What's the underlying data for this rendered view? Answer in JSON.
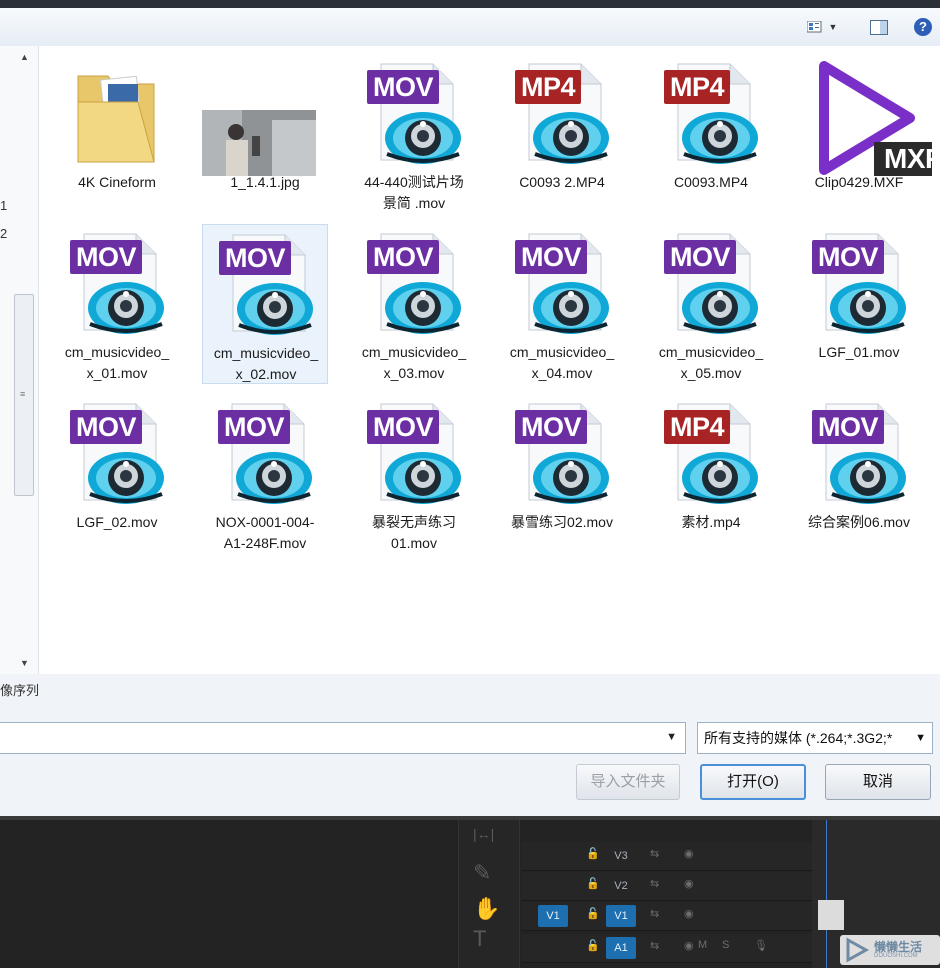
{
  "toolbar": {
    "view_icon": "views-icon",
    "preview_icon": "preview-pane-icon",
    "help_label": "?"
  },
  "sidebar": {
    "numbers": [
      "1",
      "2"
    ]
  },
  "colors": {
    "mov": "#6b2fa3",
    "mp4": "#a82323",
    "mxf": "#7a2fc8",
    "reel": "#10a8d6",
    "selected": "#eaf2fb"
  },
  "files": [
    {
      "kind": "folder",
      "line1": "4K Cineform",
      "line2": ""
    },
    {
      "kind": "image",
      "line1": "1_1.4.1.jpg",
      "line2": ""
    },
    {
      "kind": "video",
      "ext": "MOV",
      "line1": "44-440测试片场",
      "line2": "景简 .mov"
    },
    {
      "kind": "video",
      "ext": "MP4",
      "line1": "C0093 2.MP4",
      "line2": ""
    },
    {
      "kind": "video",
      "ext": "MP4",
      "line1": "C0093.MP4",
      "line2": ""
    },
    {
      "kind": "mxf",
      "ext": "MXF",
      "line1": "Clip0429.MXF",
      "line2": ""
    },
    {
      "kind": "video",
      "ext": "MOV",
      "line1": "cm_musicvideo_",
      "line2": "x_01.mov"
    },
    {
      "kind": "video",
      "ext": "MOV",
      "line1": "cm_musicvideo_",
      "line2": "x_02.mov",
      "selected": true
    },
    {
      "kind": "video",
      "ext": "MOV",
      "line1": "cm_musicvideo_",
      "line2": "x_03.mov"
    },
    {
      "kind": "video",
      "ext": "MOV",
      "line1": "cm_musicvideo_",
      "line2": "x_04.mov"
    },
    {
      "kind": "video",
      "ext": "MOV",
      "line1": "cm_musicvideo_",
      "line2": "x_05.mov"
    },
    {
      "kind": "video",
      "ext": "MOV",
      "line1": "LGF_01.mov",
      "line2": ""
    },
    {
      "kind": "video",
      "ext": "MOV",
      "line1": "LGF_02.mov",
      "line2": ""
    },
    {
      "kind": "video",
      "ext": "MOV",
      "line1": "NOX-0001-004-",
      "line2": "A1-248F.mov"
    },
    {
      "kind": "video",
      "ext": "MOV",
      "line1": "暴裂无声练习",
      "line2": "01.mov"
    },
    {
      "kind": "video",
      "ext": "MOV",
      "line1": "暴雪练习02.mov",
      "line2": ""
    },
    {
      "kind": "video",
      "ext": "MP4",
      "line1": "素材.mp4",
      "line2": ""
    },
    {
      "kind": "video",
      "ext": "MOV",
      "line1": "综合案例06.mov",
      "line2": ""
    }
  ],
  "bottom": {
    "sequence_label": "像序列",
    "filename_value": "",
    "filter_value": "所有支持的媒体 (*.264;*.3G2;*",
    "import_folder_label": "导入文件夹",
    "open_label": "打开(O)",
    "cancel_label": "取消"
  },
  "timeline": {
    "tracks": [
      {
        "name": "V3",
        "source": ""
      },
      {
        "name": "V2",
        "source": ""
      },
      {
        "name": "V1",
        "source": "V1"
      },
      {
        "name": "A1",
        "source": ""
      }
    ],
    "track_m": "M",
    "track_s": "S"
  },
  "watermark": {
    "text": "懒懒生活",
    "sub": "DOUOSHI.COM"
  }
}
